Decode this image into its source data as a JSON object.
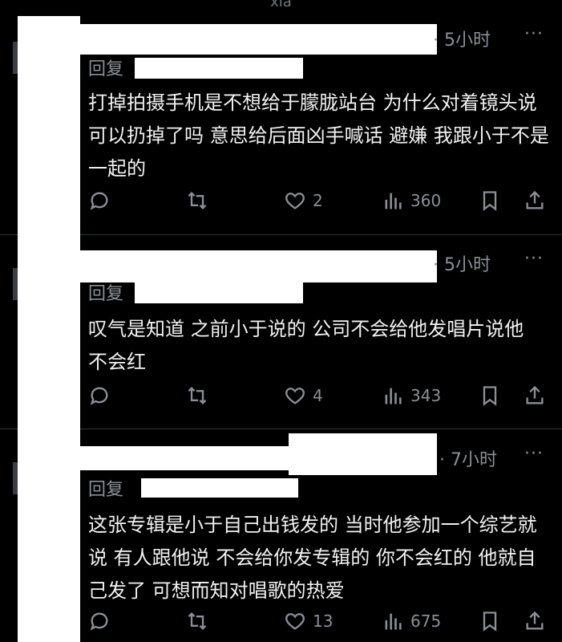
{
  "header": {
    "title": "xia"
  },
  "posts": [
    {
      "time": "· 5小时",
      "more": "···",
      "reply_label": "回复",
      "text": "打掉拍摄手机是不想给于朦胧站台 为什么对着镜头说可以扔掉了吗 意思给后面凶手喊话 避嫌 我跟小于不是一起的",
      "likes": "2",
      "views": "360"
    },
    {
      "time": "· 5小时",
      "more": "···",
      "reply_label": "回复",
      "text": "叹气是知道 之前小于说的 公司不会给他发唱片说他不会红",
      "likes": "4",
      "views": "343"
    },
    {
      "time": "· 7小时",
      "more": "···",
      "reply_label": "回复",
      "text": "这张专辑是小于自己出钱发的 当时他参加一个综艺就说 有人跟他说 不会给你发专辑的 你不会红的 他就自己发了 可想而知对唱歌的热爱",
      "likes": "13",
      "views": "675"
    }
  ],
  "icons": {
    "reply": "reply-icon",
    "repost": "repost-icon",
    "like": "heart-icon",
    "views": "views-icon",
    "bookmark": "bookmark-icon",
    "share": "share-icon"
  },
  "colors": {
    "background": "#000000",
    "text": "#f2f2f2",
    "muted": "#8b9096",
    "divider": "#2f3336"
  }
}
